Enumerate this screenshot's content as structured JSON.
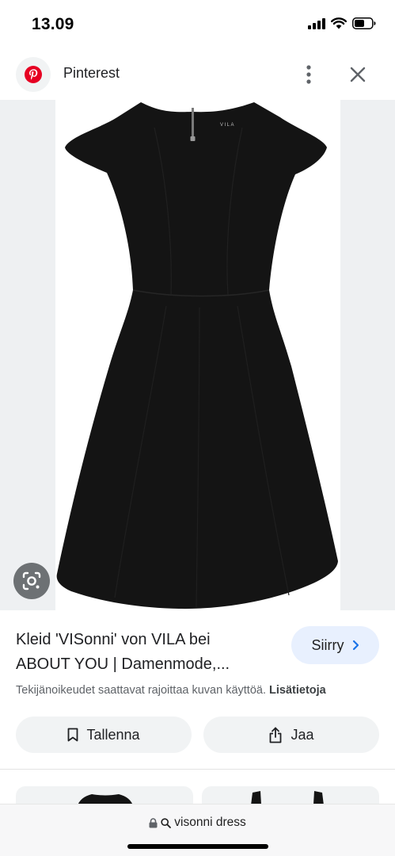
{
  "status_bar": {
    "time": "13.09"
  },
  "header": {
    "site_name": "Pinterest"
  },
  "result": {
    "title_line1": "Kleid 'VISonni' von VILA bei",
    "title_line2": "ABOUT YOU | Damenmode,...",
    "visit_label": "Siirry",
    "copyright_notice": "Tekijänoikeudet saattavat rajoittaa kuvan käyttöä.",
    "more_info_label": "Lisätietoja",
    "save_label": "Tallenna",
    "share_label": "Jaa",
    "image_brand_label": "VILA"
  },
  "address_bar": {
    "url_text": "visonni dress"
  },
  "colors": {
    "pinterest_red": "#e60023",
    "visit_button_bg": "#e8f0fe",
    "visit_chevron": "#1a73e8",
    "pill_bg": "#f1f3f4",
    "dress": "#141414"
  },
  "icons": {
    "signal": "signal-icon",
    "wifi": "wifi-icon",
    "battery": "battery-icon",
    "logo": "pinterest-logo-icon",
    "more": "more-vert-icon",
    "close": "close-icon",
    "lens": "google-lens-icon",
    "visit": "chevron-right-icon",
    "save": "bookmark-icon",
    "share": "share-icon",
    "lock": "lock-icon",
    "search": "search-icon"
  }
}
